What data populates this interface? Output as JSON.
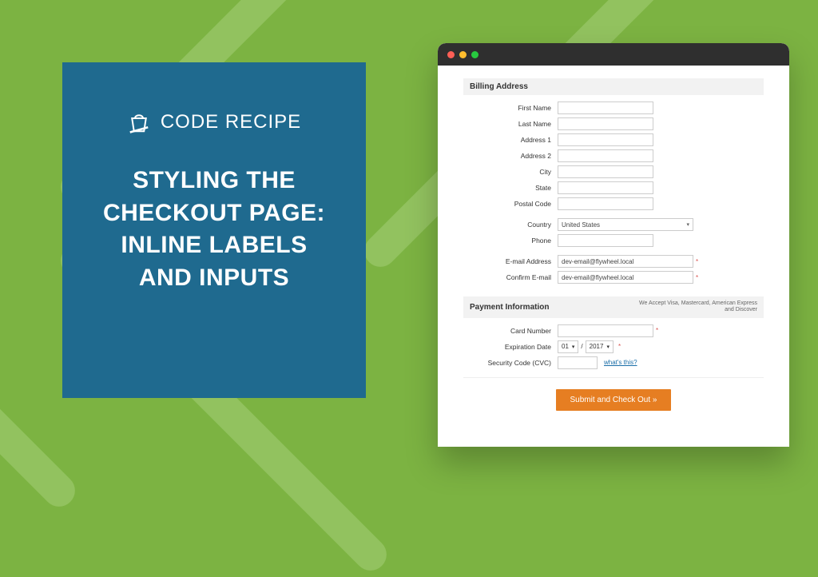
{
  "brand": {
    "title": "CODE RECIPE"
  },
  "headline": "STYLING THE CHECKOUT PAGE: INLINE LABELS AND INPUTS",
  "billing": {
    "title": "Billing Address",
    "fields": {
      "first_name": {
        "label": "First Name",
        "value": ""
      },
      "last_name": {
        "label": "Last Name",
        "value": ""
      },
      "address1": {
        "label": "Address 1",
        "value": ""
      },
      "address2": {
        "label": "Address 2",
        "value": ""
      },
      "city": {
        "label": "City",
        "value": ""
      },
      "state": {
        "label": "State",
        "value": ""
      },
      "postal": {
        "label": "Postal Code",
        "value": ""
      },
      "country": {
        "label": "Country",
        "value": "United States"
      },
      "phone": {
        "label": "Phone",
        "value": ""
      },
      "email": {
        "label": "E-mail Address",
        "value": "dev-email@flywheel.local",
        "required": true
      },
      "confirm": {
        "label": "Confirm E-mail",
        "value": "dev-email@flywheel.local",
        "required": true
      }
    }
  },
  "payment": {
    "title": "Payment Information",
    "accept_text": "We Accept Visa, Mastercard, American Express and Discover",
    "card_number": {
      "label": "Card Number",
      "value": "",
      "required": true
    },
    "expiration": {
      "label": "Expiration Date",
      "month": "01",
      "year": "2017",
      "required": true
    },
    "cvc": {
      "label": "Security Code (CVC)",
      "value": "",
      "help": "what's this?"
    }
  },
  "submit_label": "Submit and Check Out »",
  "colors": {
    "bg": "#7cb342",
    "bg_stroke": "#92c25f",
    "card": "#1f6a8f",
    "submit": "#e67e22"
  }
}
